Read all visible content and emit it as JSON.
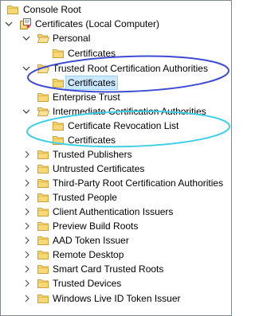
{
  "colors": {
    "folder_fill": "#f8d775",
    "folder_stroke": "#c9a13a",
    "selection_fill": "#cce8ff",
    "selection_border": "#99d1ff",
    "annotation_blue": "#3d4bd1",
    "annotation_cyan": "#3fd0e6"
  },
  "tree": {
    "console_root": "Console Root",
    "certificates_local": "Certificates (Local Computer)",
    "personal": "Personal",
    "personal_certificates": "Certificates",
    "trusted_root": "Trusted Root Certification Authorities",
    "trusted_root_certificates": "Certificates",
    "enterprise_trust": "Enterprise Trust",
    "intermediate": "Intermediate Certification Authorities",
    "intermediate_crl": "Certificate Revocation List",
    "intermediate_certificates": "Certificates",
    "trusted_publishers": "Trusted Publishers",
    "untrusted_certificates": "Untrusted Certificates",
    "third_party_root": "Third-Party Root Certification Authorities",
    "trusted_people": "Trusted People",
    "client_auth_issuers": "Client Authentication Issuers",
    "preview_build_roots": "Preview Build Roots",
    "aad_token_issuer": "AAD Token Issuer",
    "remote_desktop": "Remote Desktop",
    "smart_card_trusted_roots": "Smart Card Trusted Roots",
    "trusted_devices": "Trusted Devices",
    "windows_live_id_token_issuer": "Windows Live ID Token Issuer"
  }
}
